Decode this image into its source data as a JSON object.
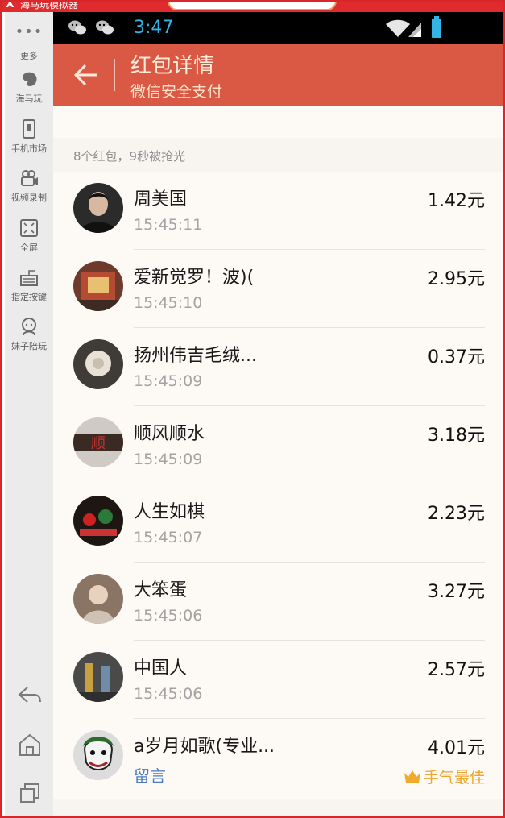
{
  "emulator": {
    "top_logo": "X",
    "top_title": "海马玩模拟器",
    "side_more": "更多",
    "side_items": [
      {
        "label": "海马玩",
        "icon": "haima-logo-icon"
      },
      {
        "label": "手机市场",
        "icon": "phone-market-icon"
      },
      {
        "label": "视频录制",
        "icon": "video-record-icon"
      },
      {
        "label": "全屏",
        "icon": "fullscreen-icon"
      },
      {
        "label": "指定按键",
        "icon": "keymap-icon"
      },
      {
        "label": "妹子陪玩",
        "icon": "companion-icon"
      }
    ],
    "nav": [
      "back-icon",
      "home-icon",
      "recent-apps-icon"
    ]
  },
  "status_bar": {
    "time": "3:47",
    "accent": "#34b4e4",
    "notifications": [
      "wechat-icon",
      "wechat-icon"
    ]
  },
  "header": {
    "title": "红包详情",
    "subtitle": "微信安全支付",
    "color": "#d95945"
  },
  "summary": "8个红包，9秒被抢光",
  "entries": [
    {
      "name": "周美国",
      "time": "15:45:11",
      "amount": "1.42元"
    },
    {
      "name": "爱新觉罗！波)(",
      "time": "15:45:10",
      "amount": "2.95元"
    },
    {
      "name": "扬州伟吉毛绒...",
      "time": "15:45:09",
      "amount": "0.37元"
    },
    {
      "name": "顺风顺水",
      "time": "15:45:09",
      "amount": "3.18元"
    },
    {
      "name": "人生如棋",
      "time": "15:45:07",
      "amount": "2.23元"
    },
    {
      "name": "大笨蛋",
      "time": "15:45:06",
      "amount": "3.27元"
    },
    {
      "name": "中国人",
      "time": "15:45:06",
      "amount": "2.57元"
    },
    {
      "name": "a岁月如歌(专业...",
      "message": "留言",
      "amount": "4.01元",
      "best_label": "手气最佳"
    }
  ]
}
